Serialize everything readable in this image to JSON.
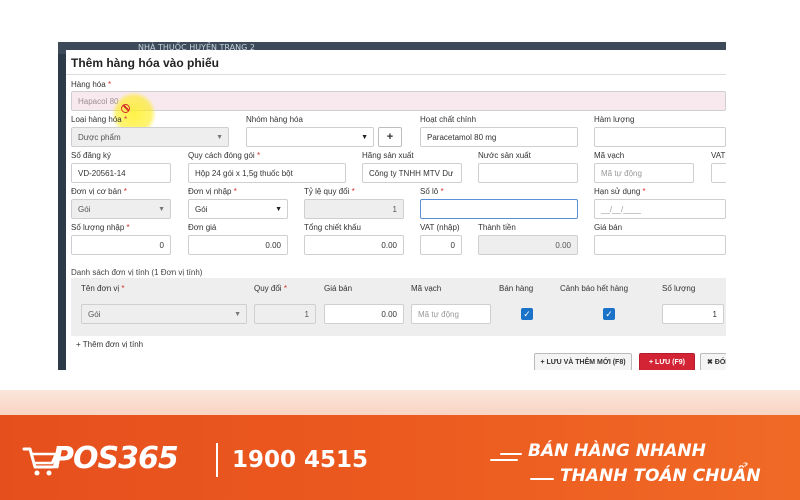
{
  "app": {
    "topbar_text": "NHÀ THUỐC HUYỀN TRANG 2"
  },
  "modal": {
    "title": "Thêm hàng hóa vào phiếu",
    "product": {
      "label": "Hàng hóa",
      "value": "Hapacol 80"
    },
    "category": {
      "label": "Loại hàng hóa",
      "value": "Dược phẩm"
    },
    "group": {
      "label": "Nhóm hàng hóa",
      "value": "",
      "add_label": "+"
    },
    "active_ingredient": {
      "label": "Hoạt chất chính",
      "value": "Paracetamol 80 mg"
    },
    "content": {
      "label": "Hàm lượng",
      "value": ""
    },
    "reg_no": {
      "label": "Số đăng ký",
      "value": "VD-20561-14"
    },
    "packaging": {
      "label": "Quy cách đóng gói",
      "value": "Hộp 24 gói x 1,5g thuốc bột"
    },
    "manufacturer": {
      "label": "Hãng sản xuất",
      "value": "Công ty TNHH MTV Dư"
    },
    "country": {
      "label": "Nước sản xuất",
      "value": ""
    },
    "barcode": {
      "label": "Mã vạch",
      "placeholder": "Mã tự động"
    },
    "vat_top": {
      "label": "VAT"
    },
    "base_unit": {
      "label": "Đơn vị cơ bản",
      "value": "Gói"
    },
    "import_unit": {
      "label": "Đơn vị nhập",
      "value": "Gói"
    },
    "ratio": {
      "label": "Tỷ lệ quy đổi",
      "value": "1"
    },
    "lot": {
      "label": "Số lô",
      "value": ""
    },
    "expiry": {
      "label": "Hạn sử dụng",
      "placeholder": "__/__/____"
    },
    "qty_import": {
      "label": "Số lượng nhập",
      "value": "0"
    },
    "unit_price": {
      "label": "Đơn giá",
      "value": "0.00"
    },
    "discount": {
      "label": "Tổng chiết khấu",
      "value": "0.00"
    },
    "vat_import": {
      "label": "VAT (nhập)",
      "value": "0"
    },
    "total": {
      "label": "Thành tiền",
      "value": "0.00"
    },
    "sell_price": {
      "label": "Giá bán",
      "value": ""
    },
    "unit_list_title": "Danh sách đơn vị tính (1 Đơn vị tính)",
    "unit_table": {
      "headers": [
        "Tên đơn vị",
        "Quy đổi",
        "Giá bán",
        "Mã vạch",
        "Bán hàng",
        "Cảnh báo hết hàng",
        "Số lượng"
      ],
      "row": {
        "unit": "Gói",
        "ratio": "1",
        "price": "0.00",
        "barcode_placeholder": "Mã tự động",
        "sell": true,
        "alert": true,
        "qty": "1"
      }
    },
    "add_unit": "+ Thêm đơn vị tính",
    "buttons": {
      "save_new": "+ LƯU VÀ THÊM MỚI (F8)",
      "save": "+ LƯU (F9)",
      "close": "✖ ĐÓNG"
    }
  },
  "footer": {
    "brand": "POS365",
    "phone": "1900 4515",
    "slogan_line1": "BÁN HÀNG NHANH",
    "slogan_line2": "THANH TOÁN CHUẨN"
  },
  "colors": {
    "footer_bg": "#e8501c",
    "save_button": "#d32435",
    "checkbox": "#1a73c8"
  }
}
